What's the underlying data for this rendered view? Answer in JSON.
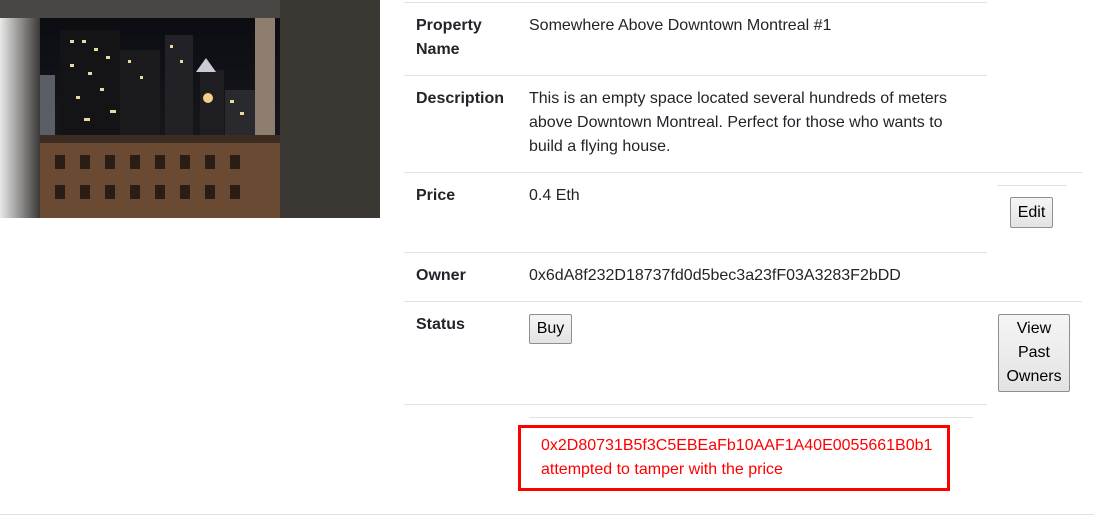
{
  "property": {
    "rows": [
      {
        "label": "Property Name",
        "value": "Somewhere Above Downtown Montreal #1"
      },
      {
        "label": "Description",
        "value": "This is an empty space located several hundreds of meters above Downtown Montreal. Perfect for those who wants to build a flying house."
      },
      {
        "label": "Price",
        "value": "0.4 Eth"
      },
      {
        "label": "Owner",
        "value": "0x6dA8f232D18737fd0d5bec3a23fF03A3283F2bDD"
      },
      {
        "label": "Status",
        "value": ""
      }
    ]
  },
  "buttons": {
    "edit": "Edit",
    "buy": "Buy",
    "view_past_owners": "View Past Owners"
  },
  "alert": {
    "address": "0x2D80731B5f3C5EBEaFb10AAF1A40E0055661B0b1",
    "message": "attempted to tamper with the price",
    "color": "#ff0000"
  },
  "image": {
    "description_icon": "night-city-photo"
  }
}
